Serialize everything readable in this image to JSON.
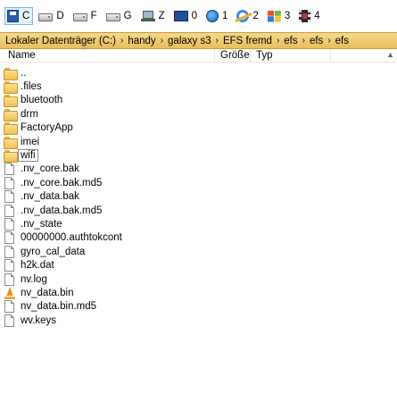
{
  "drives": [
    {
      "label": "C",
      "icon": "floppy-icon",
      "active": true
    },
    {
      "label": "D",
      "icon": "disk-drive-icon"
    },
    {
      "label": "F",
      "icon": "disk-drive-icon"
    },
    {
      "label": "G",
      "icon": "disk-drive-icon"
    },
    {
      "label": "Z",
      "icon": "network-drive-icon"
    },
    {
      "label": "0",
      "icon": "monitor-icon"
    },
    {
      "label": "1",
      "icon": "globe-icon"
    },
    {
      "label": "2",
      "icon": "internet-explorer-icon"
    },
    {
      "label": "3",
      "icon": "windows-icon"
    },
    {
      "label": "4",
      "icon": "film-icon"
    }
  ],
  "path": {
    "segments": [
      "Lokaler Datenträger (C:)",
      "handy",
      "galaxy s3",
      "EFS fremd",
      "efs",
      "efs",
      "efs"
    ],
    "separator": "›"
  },
  "columns": {
    "name": "Name",
    "size": "Größe",
    "type": "Typ",
    "sort_glyph": "^",
    "scroll_glyph": "▲"
  },
  "files": [
    {
      "name": "..",
      "kind": "folder"
    },
    {
      "name": ".files",
      "kind": "folder"
    },
    {
      "name": "bluetooth",
      "kind": "folder"
    },
    {
      "name": "drm",
      "kind": "folder"
    },
    {
      "name": "FactoryApp",
      "kind": "folder"
    },
    {
      "name": "imei",
      "kind": "folder"
    },
    {
      "name": "wifi",
      "kind": "folder",
      "focused": true
    },
    {
      "name": ".nv_core.bak",
      "kind": "file"
    },
    {
      "name": ".nv_core.bak.md5",
      "kind": "file"
    },
    {
      "name": ".nv_data.bak",
      "kind": "file"
    },
    {
      "name": ".nv_data.bak.md5",
      "kind": "file"
    },
    {
      "name": ".nv_state",
      "kind": "file"
    },
    {
      "name": "00000000.authtokcont",
      "kind": "file"
    },
    {
      "name": "gyro_cal_data",
      "kind": "file"
    },
    {
      "name": "h2k.dat",
      "kind": "file"
    },
    {
      "name": "nv.log",
      "kind": "file"
    },
    {
      "name": "nv_data.bin",
      "kind": "cone"
    },
    {
      "name": "nv_data.bin.md5",
      "kind": "file"
    },
    {
      "name": "wv.keys",
      "kind": "file"
    }
  ],
  "colors": {
    "path_bar": "#e9bd5b",
    "folder": "#f0c052",
    "active_drive": "#e5f1fb"
  }
}
